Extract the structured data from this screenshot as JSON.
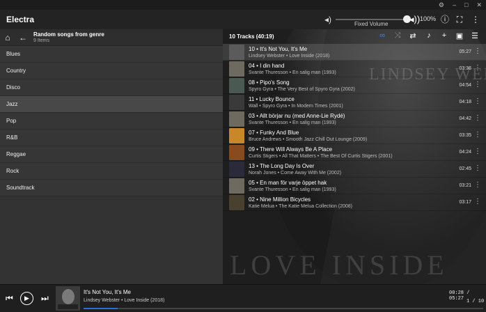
{
  "window": {
    "title": "Electra"
  },
  "volume": {
    "label": "Fixed Volume",
    "percent": "100%",
    "level": 1.0
  },
  "nav": {
    "title": "Random songs from genre",
    "subtitle": "9 Items"
  },
  "genres": [
    "Blues",
    "Country",
    "Disco",
    "Jazz",
    "Pop",
    "R&B",
    "Reggae",
    "Rock",
    "Soundtrack"
  ],
  "active_genre": "Jazz",
  "tracklist": {
    "header": "10 Tracks (40:19)",
    "tracks": [
      {
        "title": "10 • It's Not You, It's Me",
        "sub": "Lindsey Webster • Love Inside (2018)",
        "dur": "05:27",
        "color": "#5b5b5b",
        "active": true
      },
      {
        "title": "04 • I din hand",
        "sub": "Svante Thuresson • En salig man (1993)",
        "dur": "03:36",
        "color": "#6e6a60"
      },
      {
        "title": "08 • Pipo's Song",
        "sub": "Spyro Gyra • The Very Best of Spyro Gyra (2002)",
        "dur": "04:54",
        "color": "#4a5a52"
      },
      {
        "title": "11 • Lucky Bounce",
        "sub": "Wall • Spyro Gyra • In Modern Times (2001)",
        "dur": "04:18",
        "color": "#3a3a3a"
      },
      {
        "title": "03 • Allt börjar nu (med Anne-Lie Rydé)",
        "sub": "Svante Thuresson • En salig man (1993)",
        "dur": "04:42",
        "color": "#6e6a60"
      },
      {
        "title": "07 • Funky And Blue",
        "sub": "Bruce Andrews • Smooth Jazz Chill Out Lounge (2009)",
        "dur": "03:35",
        "color": "#c8882a"
      },
      {
        "title": "09 • There Will Always Be A Place",
        "sub": "Curtis Stigers • All That Matters • The Best Of Curtis Stigers (2001)",
        "dur": "04:24",
        "color": "#8a4a20"
      },
      {
        "title": "13 • The Long Day Is Over",
        "sub": "Norah Jones • Come Away With Me (2002)",
        "dur": "02:45",
        "color": "#2a2a3a"
      },
      {
        "title": "05 • En man för varje öppet hak",
        "sub": "Svante Thuresson • En salig man (1993)",
        "dur": "03:21",
        "color": "#6e6a60"
      },
      {
        "title": "02 • Nine Million Bicycles",
        "sub": "Katie Melua • The Katie Melua Collection (2008)",
        "dur": "03:17",
        "color": "#4a4030"
      }
    ]
  },
  "background_art": {
    "title": "LINDSEY WEBSTER",
    "subtitle": "LOVE INSIDE"
  },
  "player": {
    "title": "It's Not You, It's Me",
    "sub": "Lindsey Webster • Love Inside (2018)",
    "time": "00:28 / 05:27",
    "pages": "1 / 10",
    "progress": 0.086
  },
  "icons": {
    "home": "⌂",
    "back": "←",
    "volume_low": "🔈",
    "volume_high": "🔊",
    "info": "ⓘ",
    "fullscreen": "⛶",
    "more": "⋮",
    "repeat": "∞",
    "shuffle": "⤨",
    "swap": "⇄",
    "add": "+",
    "save": "💾",
    "clear": "≡×",
    "prev": "⏮",
    "play": "▶",
    "next": "⏭"
  }
}
